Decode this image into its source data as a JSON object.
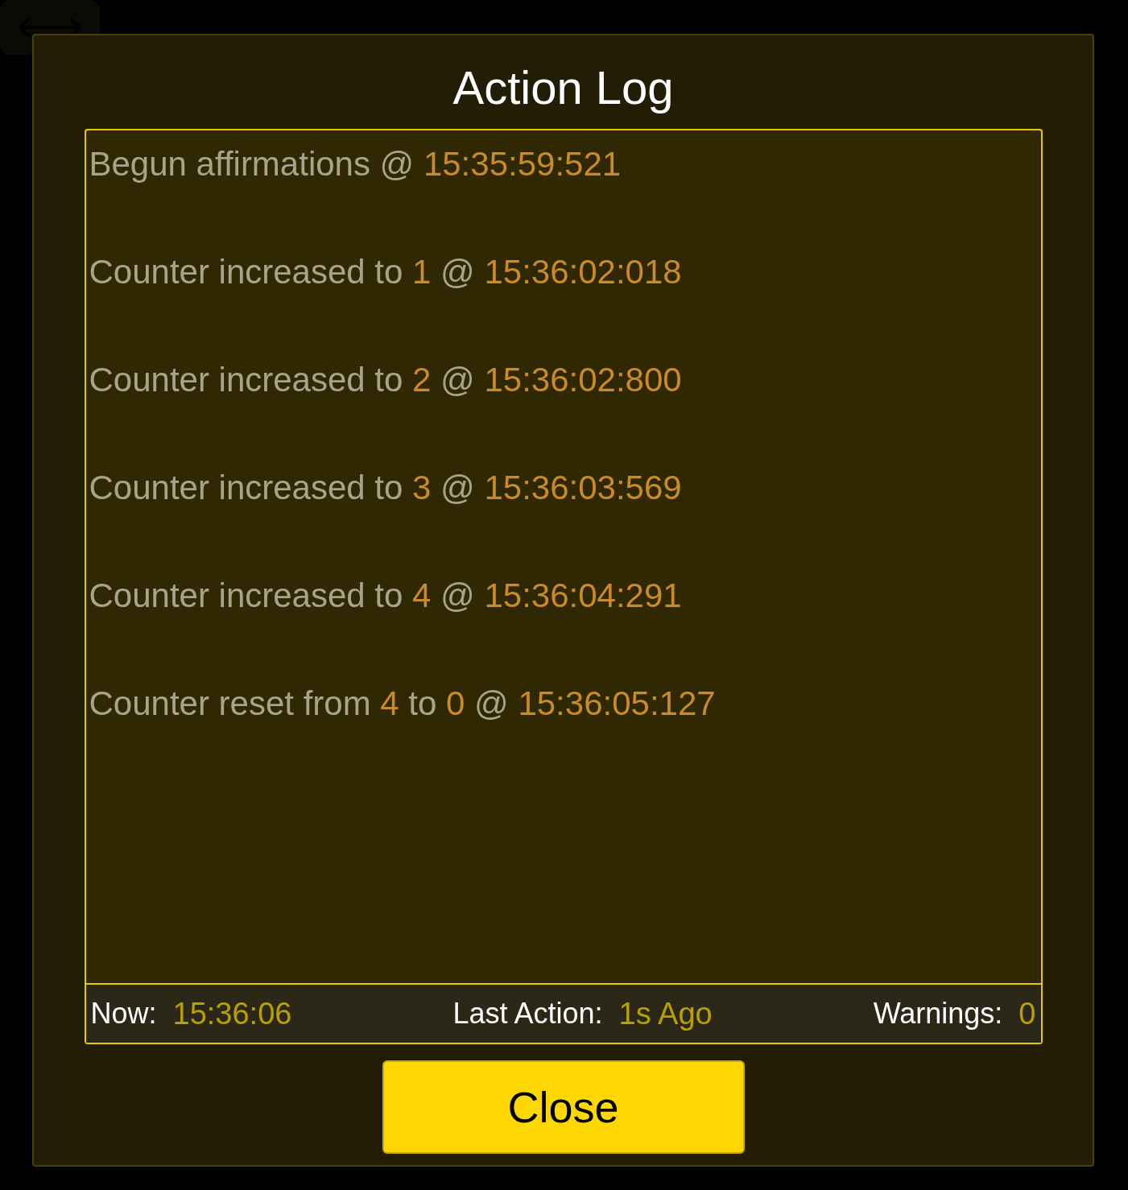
{
  "dialog": {
    "title": "Action Log"
  },
  "log": [
    {
      "parts": [
        {
          "kind": "plain",
          "text": "Begun affirmations @ "
        },
        {
          "kind": "value",
          "text": "15:35:59:521"
        }
      ]
    },
    {
      "parts": [
        {
          "kind": "plain",
          "text": "Counter increased to "
        },
        {
          "kind": "value",
          "text": "1"
        },
        {
          "kind": "plain",
          "text": " @ "
        },
        {
          "kind": "value",
          "text": "15:36:02:018"
        }
      ]
    },
    {
      "parts": [
        {
          "kind": "plain",
          "text": "Counter increased to "
        },
        {
          "kind": "value",
          "text": "2"
        },
        {
          "kind": "plain",
          "text": " @ "
        },
        {
          "kind": "value",
          "text": "15:36:02:800"
        }
      ]
    },
    {
      "parts": [
        {
          "kind": "plain",
          "text": "Counter increased to "
        },
        {
          "kind": "value",
          "text": "3"
        },
        {
          "kind": "plain",
          "text": " @ "
        },
        {
          "kind": "value",
          "text": "15:36:03:569"
        }
      ]
    },
    {
      "parts": [
        {
          "kind": "plain",
          "text": "Counter increased to "
        },
        {
          "kind": "value",
          "text": "4"
        },
        {
          "kind": "plain",
          "text": " @ "
        },
        {
          "kind": "value",
          "text": "15:36:04:291"
        }
      ]
    },
    {
      "parts": [
        {
          "kind": "plain",
          "text": "Counter reset from "
        },
        {
          "kind": "value",
          "text": "4"
        },
        {
          "kind": "plain",
          "text": " to "
        },
        {
          "kind": "value",
          "text": "0"
        },
        {
          "kind": "plain",
          "text": " @ "
        },
        {
          "kind": "value",
          "text": "15:36:05:127"
        }
      ]
    }
  ],
  "status_bar": [
    {
      "label": "Now:",
      "value": "15:36:06"
    },
    {
      "label": "Last Action:",
      "value": "1s Ago"
    },
    {
      "label": "Warnings:",
      "value": "0"
    }
  ],
  "buttons": [
    {
      "label": "Close"
    }
  ]
}
